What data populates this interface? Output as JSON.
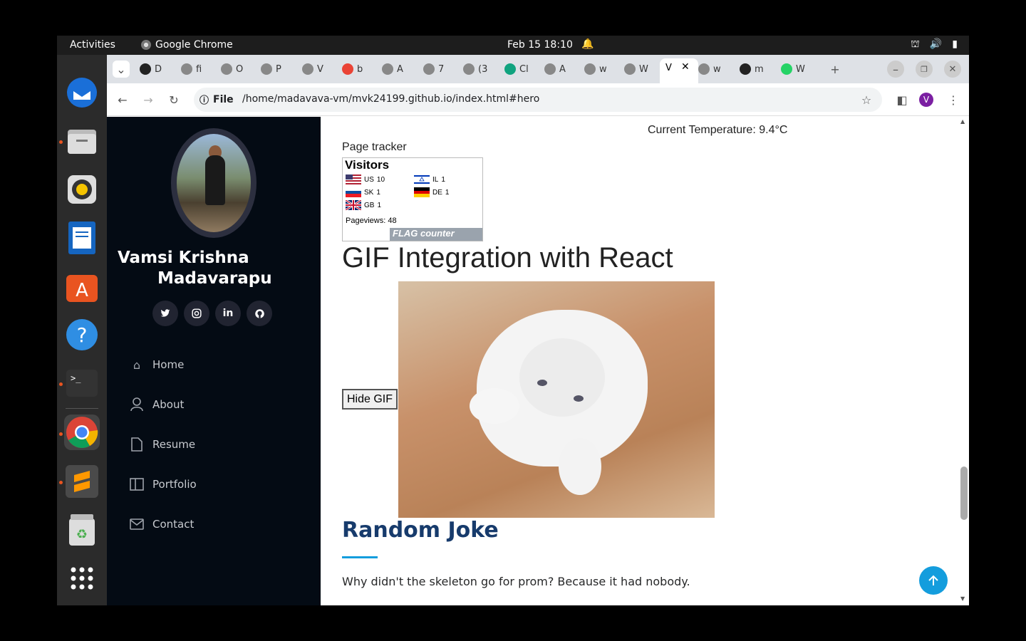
{
  "topbar": {
    "activities": "Activities",
    "app_name": "Google Chrome",
    "clock": "Feb 15  18:10"
  },
  "dock": {
    "items": [
      "thunderbird-icon",
      "files-icon",
      "rhythmbox-icon",
      "writer-icon",
      "app-center-icon",
      "help-icon",
      "terminal-icon",
      "chrome-icon",
      "sublime-icon",
      "trash-icon",
      "app-grid-icon"
    ]
  },
  "tabs": [
    {
      "label": "D",
      "icon": "github-icon"
    },
    {
      "label": "fi",
      "icon": "globe-icon"
    },
    {
      "label": "O",
      "icon": "globe-icon"
    },
    {
      "label": "P",
      "icon": "globe-icon"
    },
    {
      "label": "V",
      "icon": "globe-icon"
    },
    {
      "label": "b",
      "icon": "gmail-icon"
    },
    {
      "label": "A",
      "icon": "globe-icon"
    },
    {
      "label": "7",
      "icon": "globe-icon"
    },
    {
      "label": "(3",
      "icon": "globe-icon"
    },
    {
      "label": "Cl",
      "icon": "chatgpt-icon"
    },
    {
      "label": "A",
      "icon": "globe-icon"
    },
    {
      "label": "w",
      "icon": "globe-icon"
    },
    {
      "label": "W",
      "icon": "globe-icon"
    },
    {
      "label": "V",
      "icon": "active-tab"
    },
    {
      "label": "w",
      "icon": "globe-icon"
    },
    {
      "label": "m",
      "icon": "github-icon"
    },
    {
      "label": "W",
      "icon": "whatsapp-icon"
    }
  ],
  "omnibox": {
    "scheme_label": "File",
    "url": "/home/madavava-vm/mvk24199.github.io/index.html#hero"
  },
  "profile_initial": "V",
  "sidebar": {
    "name_line1": "Vamsi Krishna",
    "name_line2": "Madavarapu",
    "social": [
      "twitter-icon",
      "instagram-icon",
      "linkedin-icon",
      "github-icon"
    ],
    "nav": [
      {
        "label": "Home",
        "icon": "home-icon"
      },
      {
        "label": "About",
        "icon": "person-icon"
      },
      {
        "label": "Resume",
        "icon": "file-icon"
      },
      {
        "label": "Portfolio",
        "icon": "book-icon"
      },
      {
        "label": "Contact",
        "icon": "envelope-icon"
      }
    ]
  },
  "main": {
    "temperature": "Current Temperature: 9.4°C",
    "tracker_label": "Page tracker",
    "flag_counter": {
      "title": "Visitors",
      "rows": [
        {
          "code": "US",
          "count": "10"
        },
        {
          "code": "IL",
          "count": "1"
        },
        {
          "code": "SK",
          "count": "1"
        },
        {
          "code": "DE",
          "count": "1"
        },
        {
          "code": "GB",
          "count": "1"
        }
      ],
      "pageviews_label": "Pageviews:",
      "pageviews": "48",
      "brand": "FLAG counter"
    },
    "gif_title": "GIF Integration with React",
    "hide_button": "Hide GIF",
    "joke_title": "Random Joke",
    "joke_text": "Why didn't the skeleton go for prom? Because it had nobody."
  },
  "colors": {
    "sidebar_bg": "#040b14",
    "accent": "#149ddd",
    "joke_title": "#173b6c"
  }
}
